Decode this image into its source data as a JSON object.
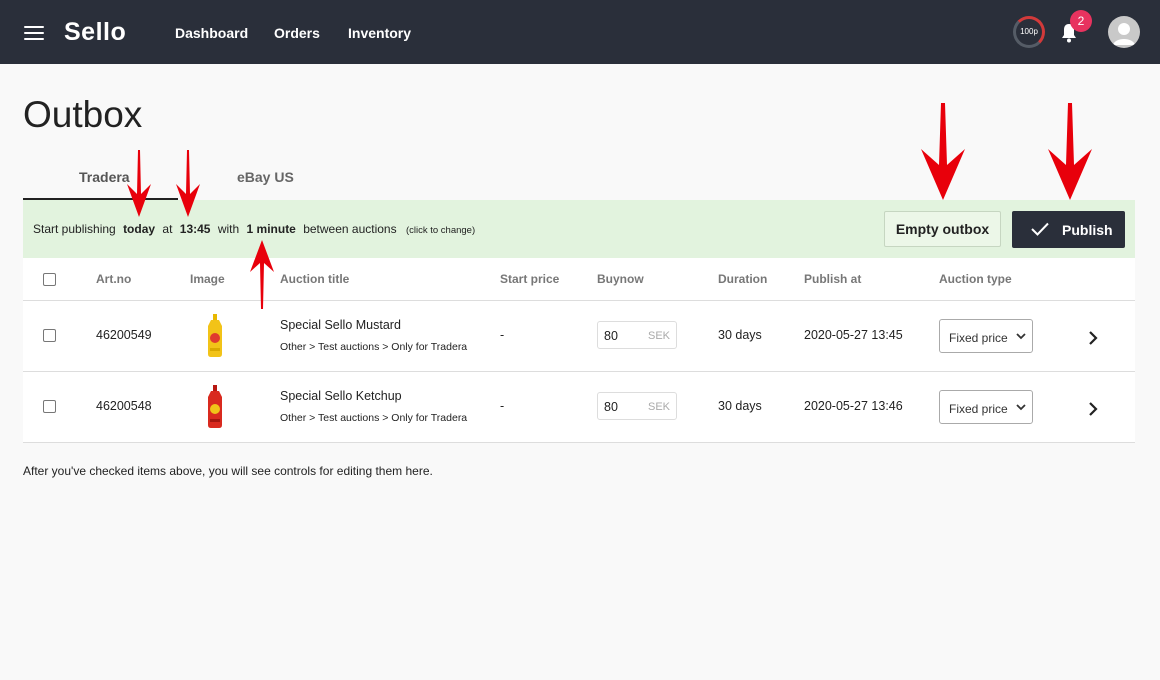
{
  "app": {
    "name": "Sello"
  },
  "nav": {
    "items": [
      "Dashboard",
      "Orders",
      "Inventory"
    ]
  },
  "header": {
    "credits": "100p",
    "notifications": "2"
  },
  "page": {
    "title": "Outbox"
  },
  "tabs": [
    "Tradera",
    "eBay US"
  ],
  "publish_bar": {
    "start": "Start publishing",
    "day": "today",
    "at": "at",
    "time": "13:45",
    "with": "with",
    "interval": "1 minute",
    "between": "between auctions",
    "hint": "(click to change)",
    "empty_button": "Empty outbox",
    "publish_button": "Publish"
  },
  "table": {
    "columns": [
      "Art.no",
      "Image",
      "Auction title",
      "Start price",
      "Buynow",
      "Duration",
      "Publish at",
      "Auction type"
    ],
    "rows": [
      {
        "art_no": "46200549",
        "image": "mustard-bottle",
        "title": "Special Sello Mustard",
        "category": "Other > Test auctions > Only for Tradera",
        "start_price": "-",
        "buynow": "80",
        "currency": "SEK",
        "duration": "30 days",
        "publish_at": "2020-05-27 13:45",
        "auction_type": "Fixed price"
      },
      {
        "art_no": "46200548",
        "image": "ketchup-bottle",
        "title": "Special Sello Ketchup",
        "category": "Other > Test auctions > Only for Tradera",
        "start_price": "-",
        "buynow": "80",
        "currency": "SEK",
        "duration": "30 days",
        "publish_at": "2020-05-27 13:46",
        "auction_type": "Fixed price"
      }
    ]
  },
  "footer_note": "After you've checked items above, you will see controls for editing them here.",
  "colors": {
    "topbar": "#2a2f3a",
    "publish_bar": "#e2f3de",
    "badge": "#e8335f",
    "annotation_arrows": "#e8000b"
  }
}
